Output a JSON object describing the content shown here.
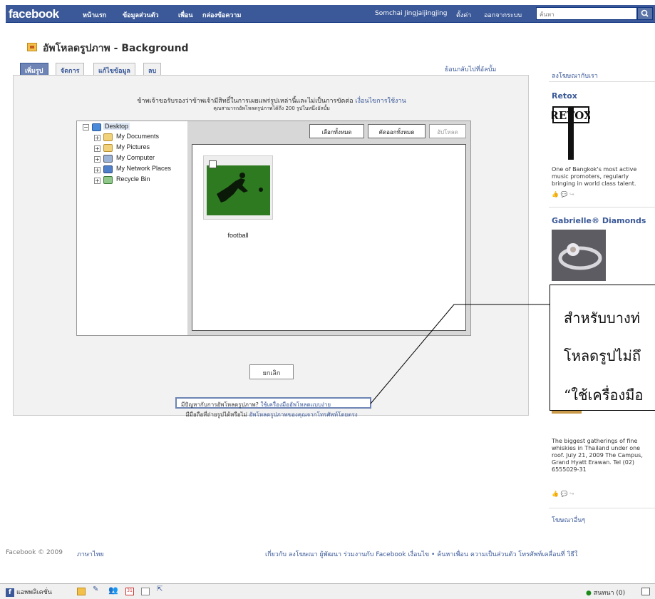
{
  "topbar": {
    "logo": "facebook",
    "nav": [
      "หน้าแรก",
      "ข้อมูลส่วนตัว",
      "เพื่อน",
      "กล่องข้อความ"
    ],
    "user": "Somchai Jingjaijingjing",
    "settings": "ตั้งค่า",
    "logout": "ออกจากระบบ",
    "search_placeholder": "ค้นหา"
  },
  "page": {
    "title": "อัพโหลดรูปภาพ - Background",
    "tabs": [
      "เพิ่มรูป",
      "จัดการ",
      "แก้ไขข้อมูล",
      "ลบ"
    ],
    "back_link": "ย้อนกลับไปที่อัลบั้ม"
  },
  "uploader": {
    "rights_text": "ข้าพเจ้าขอรับรองว่าข้าพเจ้ามีสิทธิ์ในการเผยแพร่รูปเหล่านี้และไม่เป็นการขัดต่อ",
    "terms_link": "เงื่อนไขการใช้งาน",
    "limit_text": "คุณสามารถอัพโหลดรูปภาพได้ถึง 200 รูปในหนึ่งอัลบั้ม",
    "tree": [
      "Desktop",
      "My Documents",
      "My Pictures",
      "My Computer",
      "My Network Places",
      "Recycle Bin"
    ],
    "select_all": "เลือกทั้งหมด",
    "deselect_all": "คัดออกทั้งหมด",
    "upload": "อัปโหลด",
    "thumbnail_name": "football",
    "cancel": "ยกเลิก",
    "problem_text": "มีปัญหากับการอัพโหลดรูปภาพ?",
    "simple_uploader_link": "ใช้เครื่องมืออัพโหลดแบบง่าย",
    "mobile_text": "มีมือถือที่ถ่ายรูปได้หรือไม่",
    "mobile_link": "อัพโหลดรูปภาพของคุณจากโทรศัพท์โดยตรง"
  },
  "sidebar": {
    "advertise": "ลงโฆษณากับเรา",
    "ads": [
      {
        "title": "Retox",
        "logo_text": "RETOX",
        "text": "One of Bangkok's most active music promoters, regularly bringing in world class talent."
      },
      {
        "title": "Gabrielle® Diamonds"
      },
      {
        "text": "The biggest gatherings of fine whiskies in Thailand under one roof. July 21, 2009 The Campus, Grand Hyatt Erawan. Tel (02) 6555029-31"
      }
    ],
    "more_ads": "โฆษณาอื่นๆ"
  },
  "callout": {
    "lines": [
      "สำหรับบางท่",
      "โหลดรูปไม่ถึ",
      "“ใช้เครื่องมือ"
    ]
  },
  "footer": {
    "copyright": "Facebook © 2009",
    "language": "ภาษาไทย",
    "links": "เกี่ยวกับ  ลงโฆษณา  ผู้พัฒนา  ร่วมงานกับ Facebook  เงื่อนไข  •  ค้นหาเพื่อน  ความเป็นส่วนตัว  โทรศัพท์เคลื่อนที่  วิธีใ"
  },
  "bottombar": {
    "apps": "แอพพลิเคชั่น",
    "chat": "สนทนา",
    "chat_count": "(0)"
  }
}
